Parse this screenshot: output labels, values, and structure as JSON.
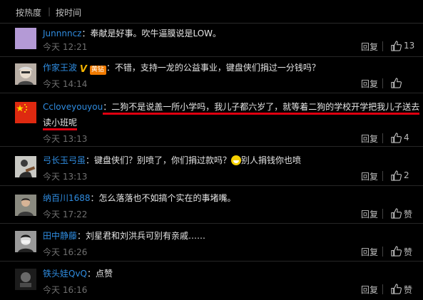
{
  "tabs": {
    "hot": "按热度",
    "separator": "|",
    "time": "按时间"
  },
  "comments": [
    {
      "user": "Junnnncz",
      "text": "：奉献是好事。吹牛逼膜说是LOW。",
      "time": "今天 12:21",
      "reply": "回复",
      "likes": "13"
    },
    {
      "user": "作家王波",
      "badge_v": "V",
      "badge_level": "黄钻",
      "text": "：不错，支持一龙的公益事业，键盘侠们捐过一分钱吗？",
      "time": "今天 14:14",
      "reply": "回复",
      "likes": ""
    },
    {
      "user": "Ccloveyouyou",
      "text_line1": "：二狗不是说盖一所小学吗，我儿子都六岁了，就等着二狗的学校开学把我儿子送去",
      "text_line2": "读小班呢",
      "time": "今天 13:13",
      "reply": "回复",
      "likes": "4"
    },
    {
      "user": "弓长玉弓虽",
      "text_before": "：键盘侠们？别喷了，你们捐过款吗？",
      "emoji": "grin-emoji",
      "text_after": "别人捐钱你也喷",
      "time": "今天 13:13",
      "reply": "回复",
      "likes": "2"
    },
    {
      "user": "纳百川1688",
      "text": "：怎么落落也不如搞个实在的事堵嘴。",
      "time": "今天 17:22",
      "reply": "回复",
      "likes": "赞"
    },
    {
      "user": "田中静藤",
      "text": "：刘星君和刘洪兵可别有亲戚……",
      "time": "今天 16:26",
      "reply": "回复",
      "likes": "赞"
    },
    {
      "user": "铁头娃QvQ",
      "text": "：点赞",
      "time": "今天 16:16",
      "reply": "回复",
      "likes": "赞"
    }
  ],
  "colors": {
    "username": "#2f8ce0",
    "highlight_underline": "#e00010",
    "background": "#000000"
  }
}
